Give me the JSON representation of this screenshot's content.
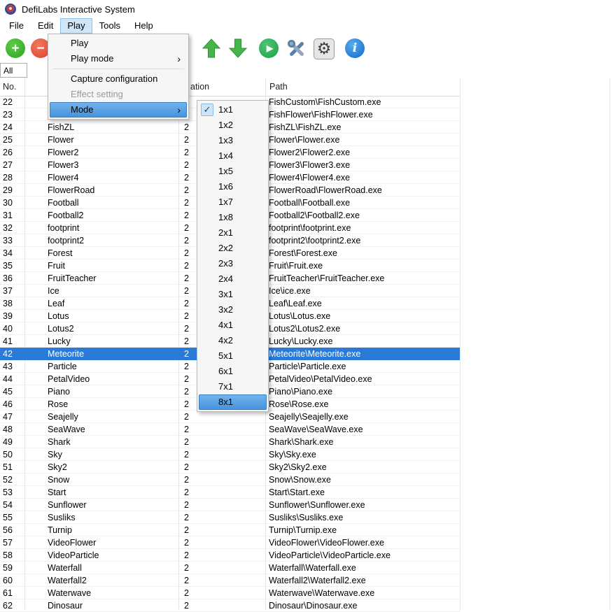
{
  "window": {
    "title": "DefiLabs Interactive System"
  },
  "menubar": {
    "items": [
      {
        "label": "File"
      },
      {
        "label": "Edit"
      },
      {
        "label": "Play",
        "active": true
      },
      {
        "label": "Tools"
      },
      {
        "label": "Help"
      }
    ]
  },
  "toolbar": {
    "icons": [
      {
        "name": "add",
        "type": "circle",
        "glyph": "+",
        "color": "#2da324",
        "highlight": "#5ecb47"
      },
      {
        "name": "remove",
        "type": "circle",
        "glyph": "−",
        "color": "#d9402b",
        "highlight": "#f2785f"
      },
      {
        "name": "move-up",
        "type": "arrow-up"
      },
      {
        "name": "move-down",
        "type": "arrow-down"
      },
      {
        "name": "play",
        "type": "circle",
        "glyph": "▶",
        "color": "#1ea04a",
        "highlight": "#4fc573"
      },
      {
        "name": "tools",
        "type": "wrench"
      },
      {
        "name": "settings",
        "type": "gear",
        "glyph": "⚙"
      },
      {
        "name": "info",
        "type": "circle",
        "glyph": "i",
        "color": "#1565c8",
        "highlight": "#55aef0"
      }
    ]
  },
  "filter": {
    "value": "All"
  },
  "icons": {
    "check": "✓",
    "submenu_arrow": "›"
  },
  "colors": {
    "selection_blue": "#2a7ad8",
    "menu_highlight_top": "#74b4ec",
    "menu_highlight_bottom": "#4392da",
    "menubar_active": "#cee6f8"
  },
  "play_menu": {
    "items": [
      {
        "label": "Play"
      },
      {
        "label": "Play mode",
        "submenu": true
      },
      {
        "separator": true
      },
      {
        "label": "Capture configuration"
      },
      {
        "label": "Effect setting",
        "disabled": true
      },
      {
        "label": "Mode",
        "submenu": true,
        "highlighted": true
      }
    ]
  },
  "mode_submenu": {
    "items": [
      {
        "label": "1x1",
        "checked": true
      },
      {
        "label": "1x2"
      },
      {
        "label": "1x3"
      },
      {
        "label": "1x4"
      },
      {
        "label": "1x5"
      },
      {
        "label": "1x6"
      },
      {
        "label": "1x7"
      },
      {
        "label": "1x8"
      },
      {
        "label": "2x1"
      },
      {
        "label": "2x2"
      },
      {
        "label": "2x3"
      },
      {
        "label": "2x4"
      },
      {
        "label": "3x1"
      },
      {
        "label": "3x2"
      },
      {
        "label": "4x1"
      },
      {
        "label": "4x2"
      },
      {
        "label": "5x1"
      },
      {
        "label": "6x1"
      },
      {
        "label": "7x1"
      },
      {
        "label": "8x1",
        "highlighted": true
      }
    ]
  },
  "table": {
    "header": {
      "no": "No.",
      "rotation_partial": "ation",
      "path": "Path"
    },
    "rows": [
      {
        "no": "22",
        "name": "",
        "rotation": "",
        "path": "FishCustom\\FishCustom.exe"
      },
      {
        "no": "23",
        "name": "",
        "rotation": "",
        "path": "FishFlower\\FishFlower.exe"
      },
      {
        "no": "24",
        "name": "FishZL",
        "rotation": "2",
        "path": "FishZL\\FishZL.exe"
      },
      {
        "no": "25",
        "name": "Flower",
        "rotation": "2",
        "path": "Flower\\Flower.exe"
      },
      {
        "no": "26",
        "name": "Flower2",
        "rotation": "2",
        "path": "Flower2\\Flower2.exe"
      },
      {
        "no": "27",
        "name": "Flower3",
        "rotation": "2",
        "path": "Flower3\\Flower3.exe"
      },
      {
        "no": "28",
        "name": "Flower4",
        "rotation": "2",
        "path": "Flower4\\Flower4.exe"
      },
      {
        "no": "29",
        "name": "FlowerRoad",
        "rotation": "2",
        "path": "FlowerRoad\\FlowerRoad.exe"
      },
      {
        "no": "30",
        "name": "Football",
        "rotation": "2",
        "path": "Football\\Football.exe"
      },
      {
        "no": "31",
        "name": "Football2",
        "rotation": "2",
        "path": "Football2\\Football2.exe"
      },
      {
        "no": "32",
        "name": "footprint",
        "rotation": "2",
        "path": "footprint\\footprint.exe"
      },
      {
        "no": "33",
        "name": "footprint2",
        "rotation": "2",
        "path": "footprint2\\footprint2.exe"
      },
      {
        "no": "34",
        "name": "Forest",
        "rotation": "2",
        "path": "Forest\\Forest.exe"
      },
      {
        "no": "35",
        "name": "Fruit",
        "rotation": "2",
        "path": "Fruit\\Fruit.exe"
      },
      {
        "no": "36",
        "name": "FruitTeacher",
        "rotation": "2",
        "path": "FruitTeacher\\FruitTeacher.exe"
      },
      {
        "no": "37",
        "name": "Ice",
        "rotation": "2",
        "path": "Ice\\ice.exe"
      },
      {
        "no": "38",
        "name": "Leaf",
        "rotation": "2",
        "path": "Leaf\\Leaf.exe"
      },
      {
        "no": "39",
        "name": "Lotus",
        "rotation": "2",
        "path": "Lotus\\Lotus.exe"
      },
      {
        "no": "40",
        "name": "Lotus2",
        "rotation": "2",
        "path": "Lotus2\\Lotus2.exe"
      },
      {
        "no": "41",
        "name": "Lucky",
        "rotation": "2",
        "path": "Lucky\\Lucky.exe"
      },
      {
        "no": "42",
        "name": "Meteorite",
        "rotation": "2",
        "path": "Meteorite\\Meteorite.exe",
        "selected": true
      },
      {
        "no": "43",
        "name": "Particle",
        "rotation": "2",
        "path": "Particle\\Particle.exe"
      },
      {
        "no": "44",
        "name": "PetalVideo",
        "rotation": "2",
        "path": "PetalVideo\\PetalVideo.exe"
      },
      {
        "no": "45",
        "name": "Piano",
        "rotation": "2",
        "path": "Piano\\Piano.exe"
      },
      {
        "no": "46",
        "name": "Rose",
        "rotation": "2",
        "path": "Rose\\Rose.exe"
      },
      {
        "no": "47",
        "name": "Seajelly",
        "rotation": "2",
        "path": "Seajelly\\Seajelly.exe"
      },
      {
        "no": "48",
        "name": "SeaWave",
        "rotation": "2",
        "path": "SeaWave\\SeaWave.exe"
      },
      {
        "no": "49",
        "name": "Shark",
        "rotation": "2",
        "path": "Shark\\Shark.exe"
      },
      {
        "no": "50",
        "name": "Sky",
        "rotation": "2",
        "path": "Sky\\Sky.exe"
      },
      {
        "no": "51",
        "name": "Sky2",
        "rotation": "2",
        "path": "Sky2\\Sky2.exe"
      },
      {
        "no": "52",
        "name": "Snow",
        "rotation": "2",
        "path": "Snow\\Snow.exe"
      },
      {
        "no": "53",
        "name": "Start",
        "rotation": "2",
        "path": "Start\\Start.exe"
      },
      {
        "no": "54",
        "name": "Sunflower",
        "rotation": "2",
        "path": "Sunflower\\Sunflower.exe"
      },
      {
        "no": "55",
        "name": "Susliks",
        "rotation": "2",
        "path": "Susliks\\Susliks.exe"
      },
      {
        "no": "56",
        "name": "Turnip",
        "rotation": "2",
        "path": "Turnip\\Turnip.exe"
      },
      {
        "no": "57",
        "name": "VideoFlower",
        "rotation": "2",
        "path": "VideoFlower\\VideoFlower.exe"
      },
      {
        "no": "58",
        "name": "VideoParticle",
        "rotation": "2",
        "path": "VideoParticle\\VideoParticle.exe"
      },
      {
        "no": "59",
        "name": "Waterfall",
        "rotation": "2",
        "path": "Waterfall\\Waterfall.exe"
      },
      {
        "no": "60",
        "name": "Waterfall2",
        "rotation": "2",
        "path": "Waterfall2\\Waterfall2.exe"
      },
      {
        "no": "61",
        "name": "Waterwave",
        "rotation": "2",
        "path": "Waterwave\\Waterwave.exe"
      },
      {
        "no": "62",
        "name": "Dinosaur",
        "rotation": "2",
        "path": "Dinosaur\\Dinosaur.exe"
      }
    ]
  }
}
